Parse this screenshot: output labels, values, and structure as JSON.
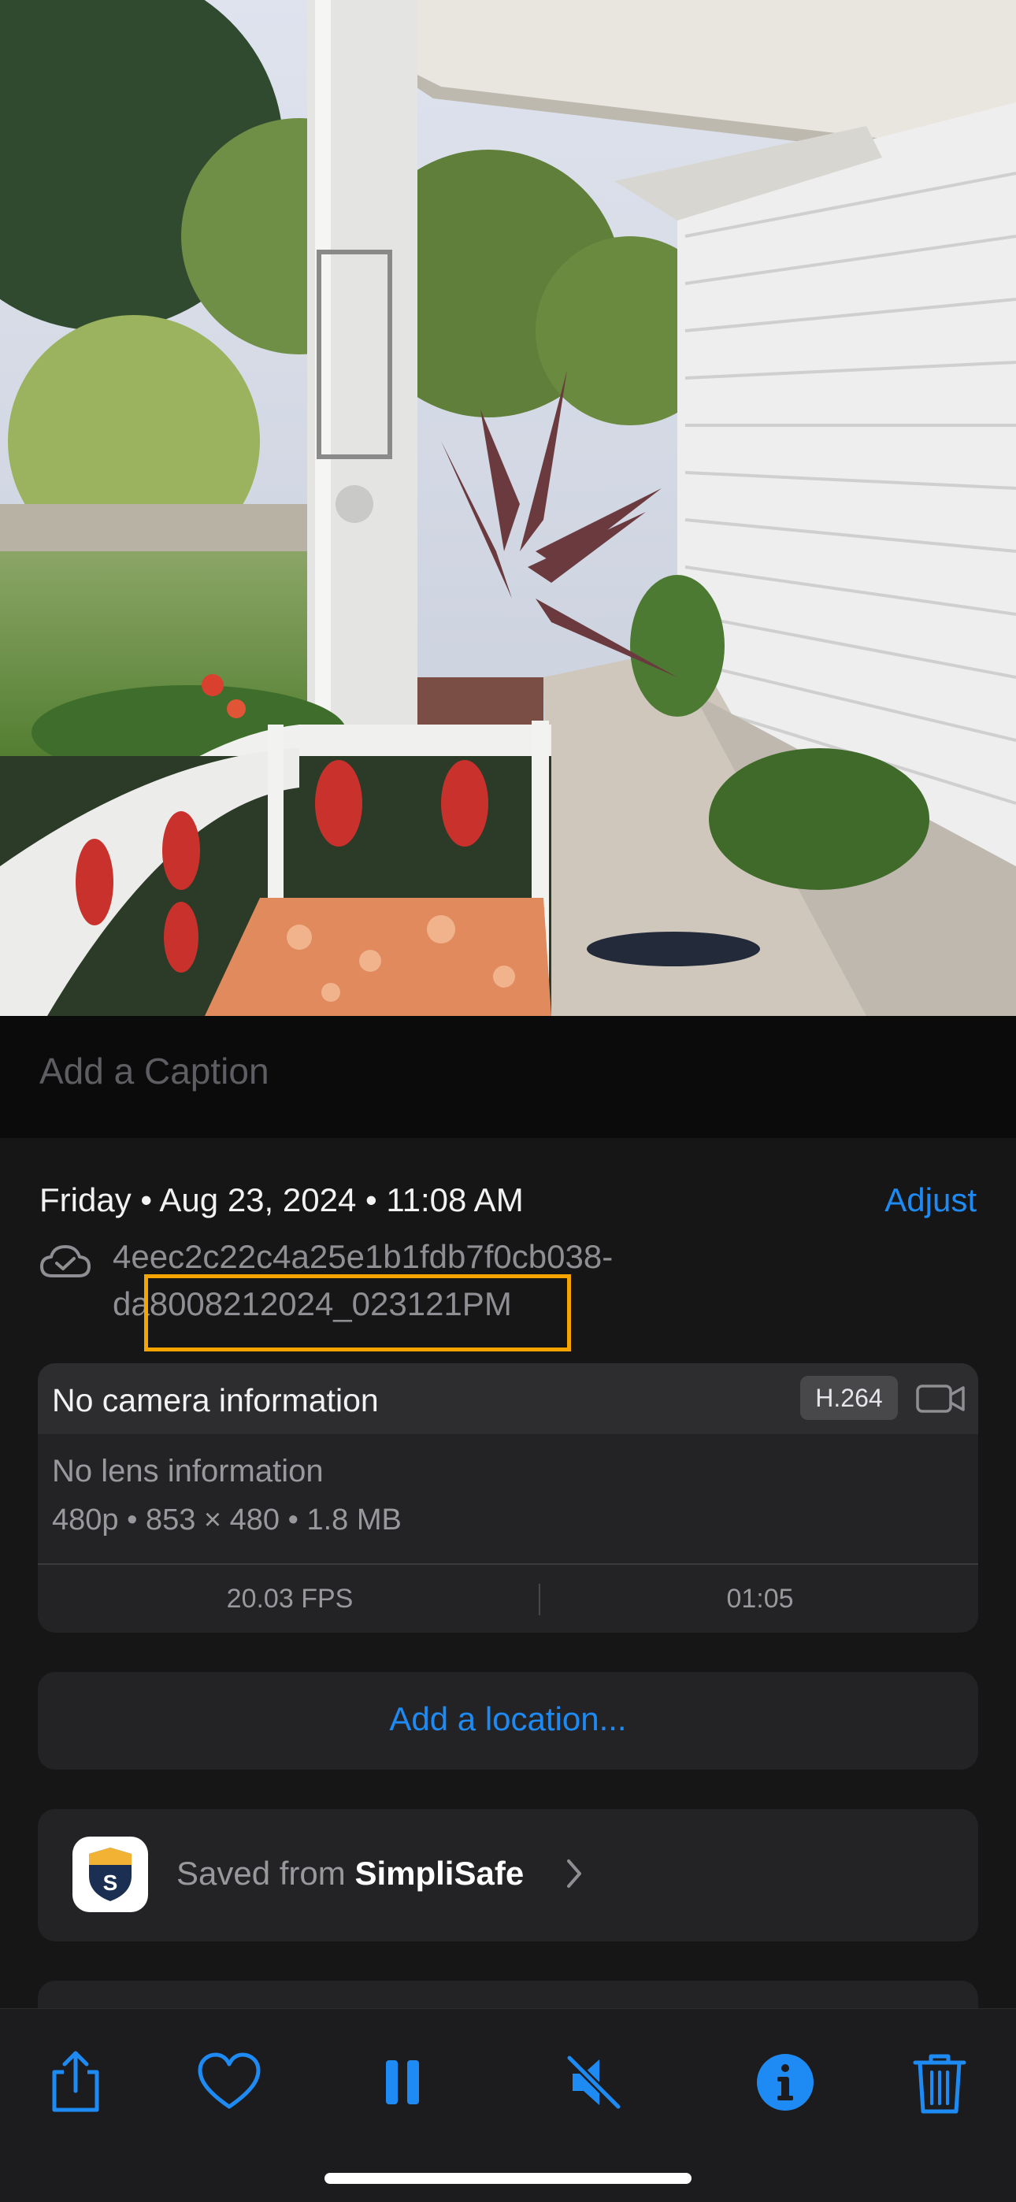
{
  "caption": {
    "placeholder": "Add a Caption"
  },
  "info": {
    "date_line": "Friday • Aug 23, 2024 • 11:08 AM",
    "adjust_label": "Adjust",
    "file_name_line1": "4eec2c22c4a25e1b1fdb7f0cb038-",
    "file_name_line2": "da8008212024_023121PM"
  },
  "camera": {
    "title": "No camera information",
    "codec": "H.264",
    "lens": "No lens information",
    "specs": "480p  •  853 × 480  •  1.8 MB",
    "fps": "20.03 FPS",
    "duration": "01:05"
  },
  "location": {
    "add_label": "Add a location..."
  },
  "source": {
    "prefix": "Saved from ",
    "app_name": "SimpliSafe",
    "app_icon_letter": "S"
  },
  "toolbar": {
    "icons": [
      "share-icon",
      "heart-icon",
      "pause-icon",
      "mute-icon",
      "info-icon",
      "trash-icon"
    ]
  },
  "colors": {
    "accent": "#1e8bf5",
    "highlight": "#f5a400",
    "card": "#232325"
  }
}
